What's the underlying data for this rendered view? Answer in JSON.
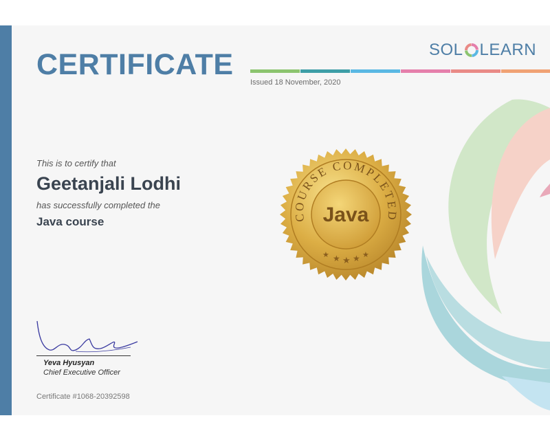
{
  "certificate": {
    "title": "CERTIFICATE",
    "issued": "Issued 18 November, 2020",
    "certify_text": "This is to certify that",
    "recipient": "Geetanjali Lodhi",
    "completed_text": "has successfully completed the",
    "course": "Java course",
    "number": "Certificate #1068-20392598"
  },
  "logo": {
    "left": "SOL",
    "right": "LEARN"
  },
  "seal": {
    "arc_text": "COURSE COMPLETED",
    "center_text": "Java"
  },
  "signature": {
    "name": "Yeva Hyusyan",
    "role": "Chief Executive Officer"
  },
  "colors": {
    "brand_blue": "#4e7ea6",
    "stripes": [
      "#8cc46f",
      "#3e9ea7",
      "#5ab8e3",
      "#e57fab",
      "#e98a86",
      "#f0a274"
    ],
    "seal_gold": "#d9a93a"
  }
}
